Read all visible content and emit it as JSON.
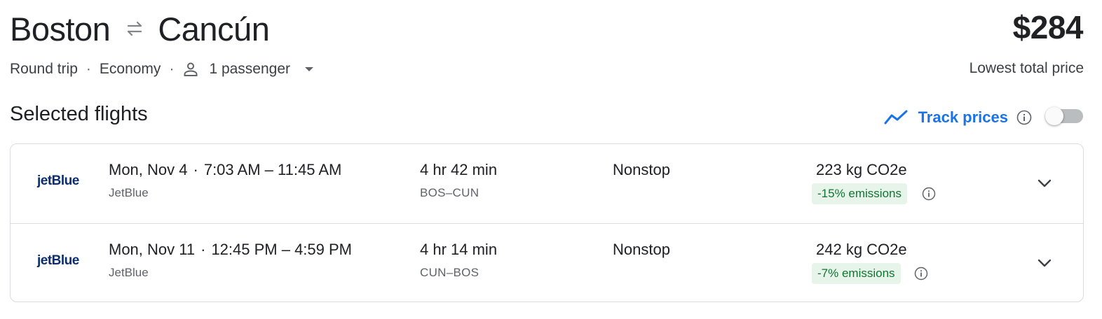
{
  "header": {
    "origin": "Boston",
    "destination": "Cancún",
    "swap_icon": "swap-arrows-icon"
  },
  "trip": {
    "type": "Round trip",
    "cabin": "Economy",
    "passengers": "1 passenger",
    "separator": "·"
  },
  "price": {
    "amount": "$284",
    "label": "Lowest total price"
  },
  "section": {
    "title": "Selected flights"
  },
  "track_prices": {
    "label": "Track prices",
    "enabled": false,
    "accent_color": "#1a73e8"
  },
  "flights": [
    {
      "airline_logo": "jetBlue",
      "date": "Mon, Nov 4",
      "time_range": "7:03 AM – 11:45 AM",
      "airline": "JetBlue",
      "duration": "4 hr 42 min",
      "route": "BOS–CUN",
      "stops": "Nonstop",
      "co2": "223 kg CO2e",
      "emissions_badge": "-15% emissions"
    },
    {
      "airline_logo": "jetBlue",
      "date": "Mon, Nov 11",
      "time_range": "12:45 PM – 4:59 PM",
      "airline": "JetBlue",
      "duration": "4 hr 14 min",
      "route": "CUN–BOS",
      "stops": "Nonstop",
      "co2": "242 kg CO2e",
      "emissions_badge": "-7% emissions"
    }
  ],
  "colors": {
    "emissions_badge_bg": "#e6f4ea",
    "emissions_badge_text": "#137333",
    "logo_color": "#0b2e6f"
  }
}
